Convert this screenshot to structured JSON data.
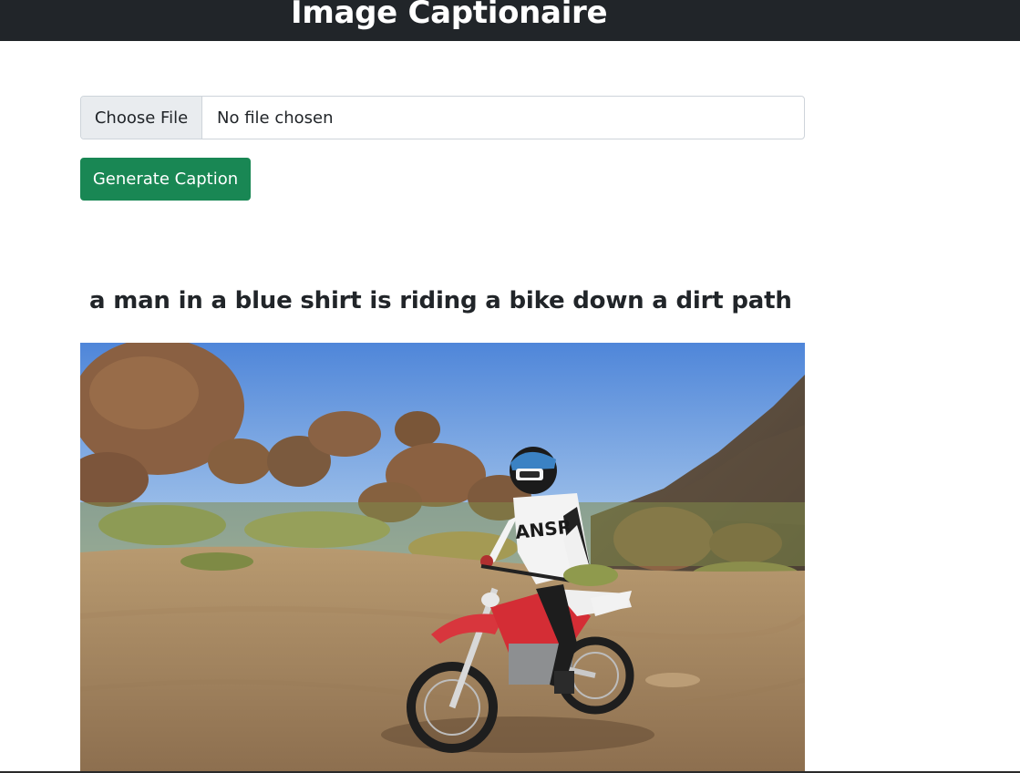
{
  "header": {
    "title": "Image Captionaire"
  },
  "upload": {
    "choose_label": "Choose File",
    "status_text": "No file chosen"
  },
  "actions": {
    "generate_label": "Generate Caption"
  },
  "result": {
    "caption": "a man in a blue shirt is riding a bike down a dirt path"
  },
  "colors": {
    "navbar_bg": "#212529",
    "button_green": "#198754",
    "file_button_bg": "#e9ecef",
    "text_dark": "#212529"
  }
}
